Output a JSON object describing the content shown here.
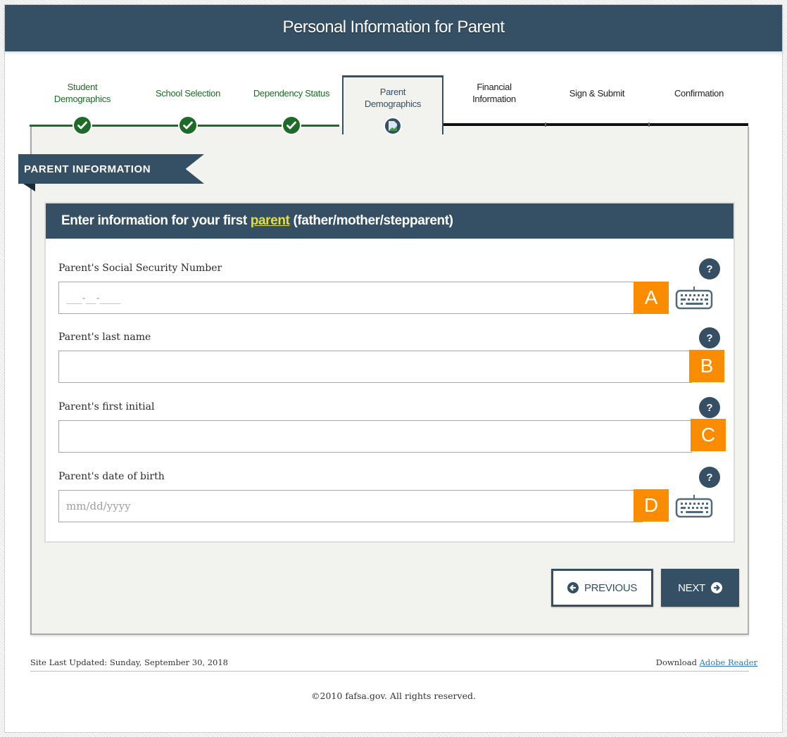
{
  "header": {
    "title": "Personal Information for Parent"
  },
  "steps": [
    {
      "label_line1": "Student",
      "label_line2": "Demographics",
      "status": "complete"
    },
    {
      "label_line1": "School Selection",
      "label_line2": "",
      "status": "complete"
    },
    {
      "label_line1": "Dependency Status",
      "label_line2": "",
      "status": "complete"
    },
    {
      "label_line1": "Parent",
      "label_line2": "Demographics",
      "status": "current"
    },
    {
      "label_line1": "Financial",
      "label_line2": "Information",
      "status": "upcoming"
    },
    {
      "label_line1": "Sign & Submit",
      "label_line2": "",
      "status": "upcoming"
    },
    {
      "label_line1": "Confirmation",
      "label_line2": "",
      "status": "upcoming"
    }
  ],
  "section": {
    "ribbon_label": "PARENT INFORMATION"
  },
  "form": {
    "header_prefix": "Enter information for your first",
    "header_link": "parent",
    "header_suffix": "(father/mother/stepparent)",
    "fields": [
      {
        "label": "Parent's Social Security Number",
        "value": "",
        "placeholder": "___-__-____",
        "marker": "A",
        "has_keyboard": true
      },
      {
        "label": "Parent's last name",
        "value": "",
        "placeholder": "",
        "marker": "B",
        "has_keyboard": false
      },
      {
        "label": "Parent's first initial",
        "value": "",
        "placeholder": "",
        "marker": "C",
        "has_keyboard": false
      },
      {
        "label": "Parent's date of birth",
        "value": "",
        "placeholder": "mm/dd/yyyy",
        "marker": "D",
        "has_keyboard": true
      }
    ],
    "help_glyph": "?"
  },
  "nav": {
    "previous_label": "PREVIOUS",
    "next_label": "NEXT"
  },
  "footer": {
    "last_updated": "Site Last Updated: Sunday, September 30, 2018",
    "download_prefix": "Download",
    "download_link": "Adobe Reader",
    "copyright": "©2010 fafsa.gov. All rights reserved."
  },
  "colors": {
    "primary": "#354f64",
    "complete_green": "#1e6a27",
    "marker_orange": "#fb8c00",
    "glossary_yellow": "#e5e030",
    "panel_bg": "#f2f2ee"
  }
}
